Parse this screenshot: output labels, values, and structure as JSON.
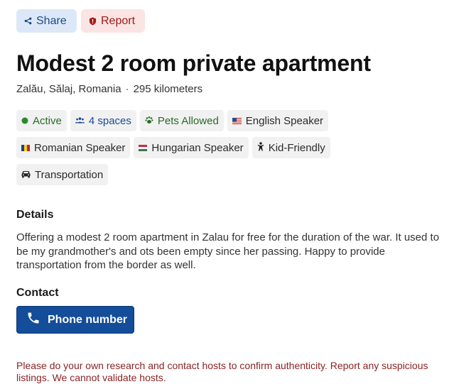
{
  "actions": {
    "share_label": "Share",
    "report_label": "Report"
  },
  "listing": {
    "title": "Modest 2 room private apartment",
    "location": "Zalău, Sălaj, Romania",
    "distance": "295 kilometers"
  },
  "tags": [
    {
      "label": "Active",
      "icon": "status-dot-icon"
    },
    {
      "label": "4 spaces",
      "icon": "people-icon"
    },
    {
      "label": "Pets Allowed",
      "icon": "paw-icon"
    },
    {
      "label": "English Speaker",
      "icon": "us-flag-icon"
    },
    {
      "label": "Romanian Speaker",
      "icon": "romania-flag-icon"
    },
    {
      "label": "Hungarian Speaker",
      "icon": "hungary-flag-icon"
    },
    {
      "label": "Kid-Friendly",
      "icon": "child-icon"
    },
    {
      "label": "Transportation",
      "icon": "car-icon"
    }
  ],
  "details": {
    "heading": "Details",
    "body": "Offering a modest 2 room apartment in Zalau for free for the duration of the war.  It used to be my grandmother's and ots been empty since her passing. Happy to provide transportation from the border as well."
  },
  "contact": {
    "heading": "Contact",
    "phone_label": "Phone number"
  },
  "disclaimer": "Please do your own research and contact hosts to confirm authenticity. Report any suspicious listings. We cannot validate hosts.",
  "colors": {
    "primary_button": "#144d99",
    "share_bg": "#dce8f7",
    "report_bg": "#fbe4e4",
    "active_green": "#2a6b2a",
    "disclaimer_red": "#8a2323"
  }
}
